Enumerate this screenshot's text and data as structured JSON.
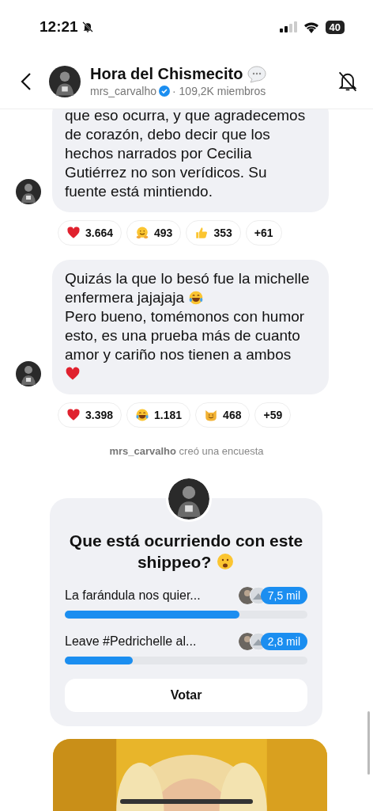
{
  "status_bar": {
    "time": "12:21",
    "battery": "40"
  },
  "header": {
    "title": "Hora del Chismecito",
    "username": "mrs_carvalho",
    "members": "· 109,2K miembros"
  },
  "messages": [
    {
      "parts": [
        {
          "kind": "text",
          "text": "que eso ocurra, y que agradecemos"
        },
        {
          "kind": "text",
          "text": "de corazón, debo decir que los"
        },
        {
          "kind": "text",
          "text": "hechos narrados por Cecilia"
        },
        {
          "kind": "text",
          "text": "Gutiérrez no son verídicos. Su"
        },
        {
          "kind": "text",
          "text": "fuente está mintiendo."
        }
      ],
      "reactions": [
        {
          "kind": "heart",
          "count": "3.664"
        },
        {
          "kind": "hug",
          "count": "493"
        },
        {
          "kind": "thumbs",
          "count": "353"
        },
        {
          "kind": "more",
          "count": "+61"
        }
      ]
    },
    {
      "parts": [
        {
          "kind": "text",
          "text": "Quizás la que lo besó fue la michelle"
        },
        {
          "kind": "text",
          "text": "enfermera jajajaja"
        },
        {
          "kind": "laugh"
        },
        {
          "kind": "text",
          "text": "Pero bueno, tomémonos con humor"
        },
        {
          "kind": "text",
          "text": "esto, es una prueba más de cuanto"
        },
        {
          "kind": "text",
          "text": "amor y cariño nos tienen a ambos"
        },
        {
          "kind": "heart",
          "own_line": true
        }
      ],
      "reactions": [
        {
          "kind": "heart",
          "count": "3.398"
        },
        {
          "kind": "laugh",
          "count": "1.181"
        },
        {
          "kind": "cat",
          "count": "468"
        },
        {
          "kind": "more",
          "count": "+59"
        }
      ]
    }
  ],
  "system_note": {
    "user": "mrs_carvalho",
    "text": "creó una encuesta"
  },
  "poll": {
    "question": [
      "Que está ocurriendo con este",
      "shippeo?"
    ],
    "options": [
      {
        "label": "La farándula nos quier...",
        "count": "7,5 mil",
        "level": 0.72
      },
      {
        "label": "Leave #Pedrichelle al...",
        "count": "2,8 mil",
        "level": 0.28
      }
    ],
    "vote_button": "Votar"
  }
}
